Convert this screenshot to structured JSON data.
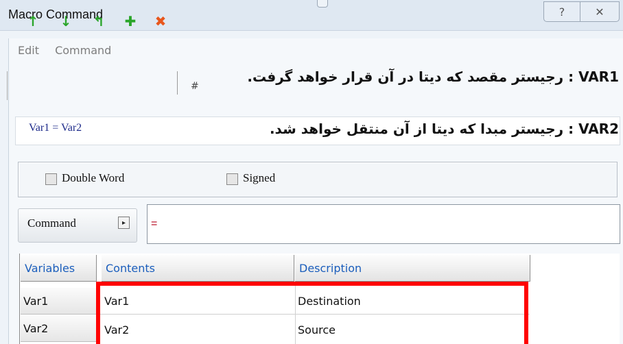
{
  "window": {
    "title": "Macro Command",
    "help_glyph": "?",
    "close_glyph": "✕"
  },
  "menu": {
    "items": [
      "Edit",
      "Command"
    ]
  },
  "toolbar": {
    "buttons": [
      {
        "name": "move-up-icon",
        "glyph": "↑",
        "color": "#2aa52a"
      },
      {
        "name": "move-down-icon",
        "glyph": "↓",
        "color": "#2aa52a"
      },
      {
        "name": "swap-icon",
        "glyph": "↰",
        "color": "#2aa52a"
      },
      {
        "name": "add-icon",
        "glyph": "✚",
        "color": "#2aa52a"
      },
      {
        "name": "delete-icon",
        "glyph": "✖",
        "color": "#e8561c"
      }
    ],
    "hash": "#"
  },
  "annotations": {
    "var1_text": "VAR1 : رجیستر مقصد که دیتا در آن قرار خواهد گرفت.",
    "var2_text": "VAR2 : رجیستر مبدا که دیتا از آن منتقل خواهد شد."
  },
  "expression": "Var1 = Var2",
  "options": {
    "double_word_label": "Double Word",
    "signed_label": "Signed"
  },
  "command": {
    "button_label": "Command",
    "arrow_glyph": "▸",
    "input_value": "="
  },
  "table": {
    "headers": [
      "Variables",
      "Contents",
      "Description"
    ],
    "rows": [
      {
        "variable": "Var1",
        "contents": "Var1",
        "description": "Destination"
      },
      {
        "variable": "Var2",
        "contents": "Var2",
        "description": "Source"
      }
    ]
  },
  "colors": {
    "accent_header_text": "#1b5ebc",
    "highlight_box": "#ff0000"
  }
}
